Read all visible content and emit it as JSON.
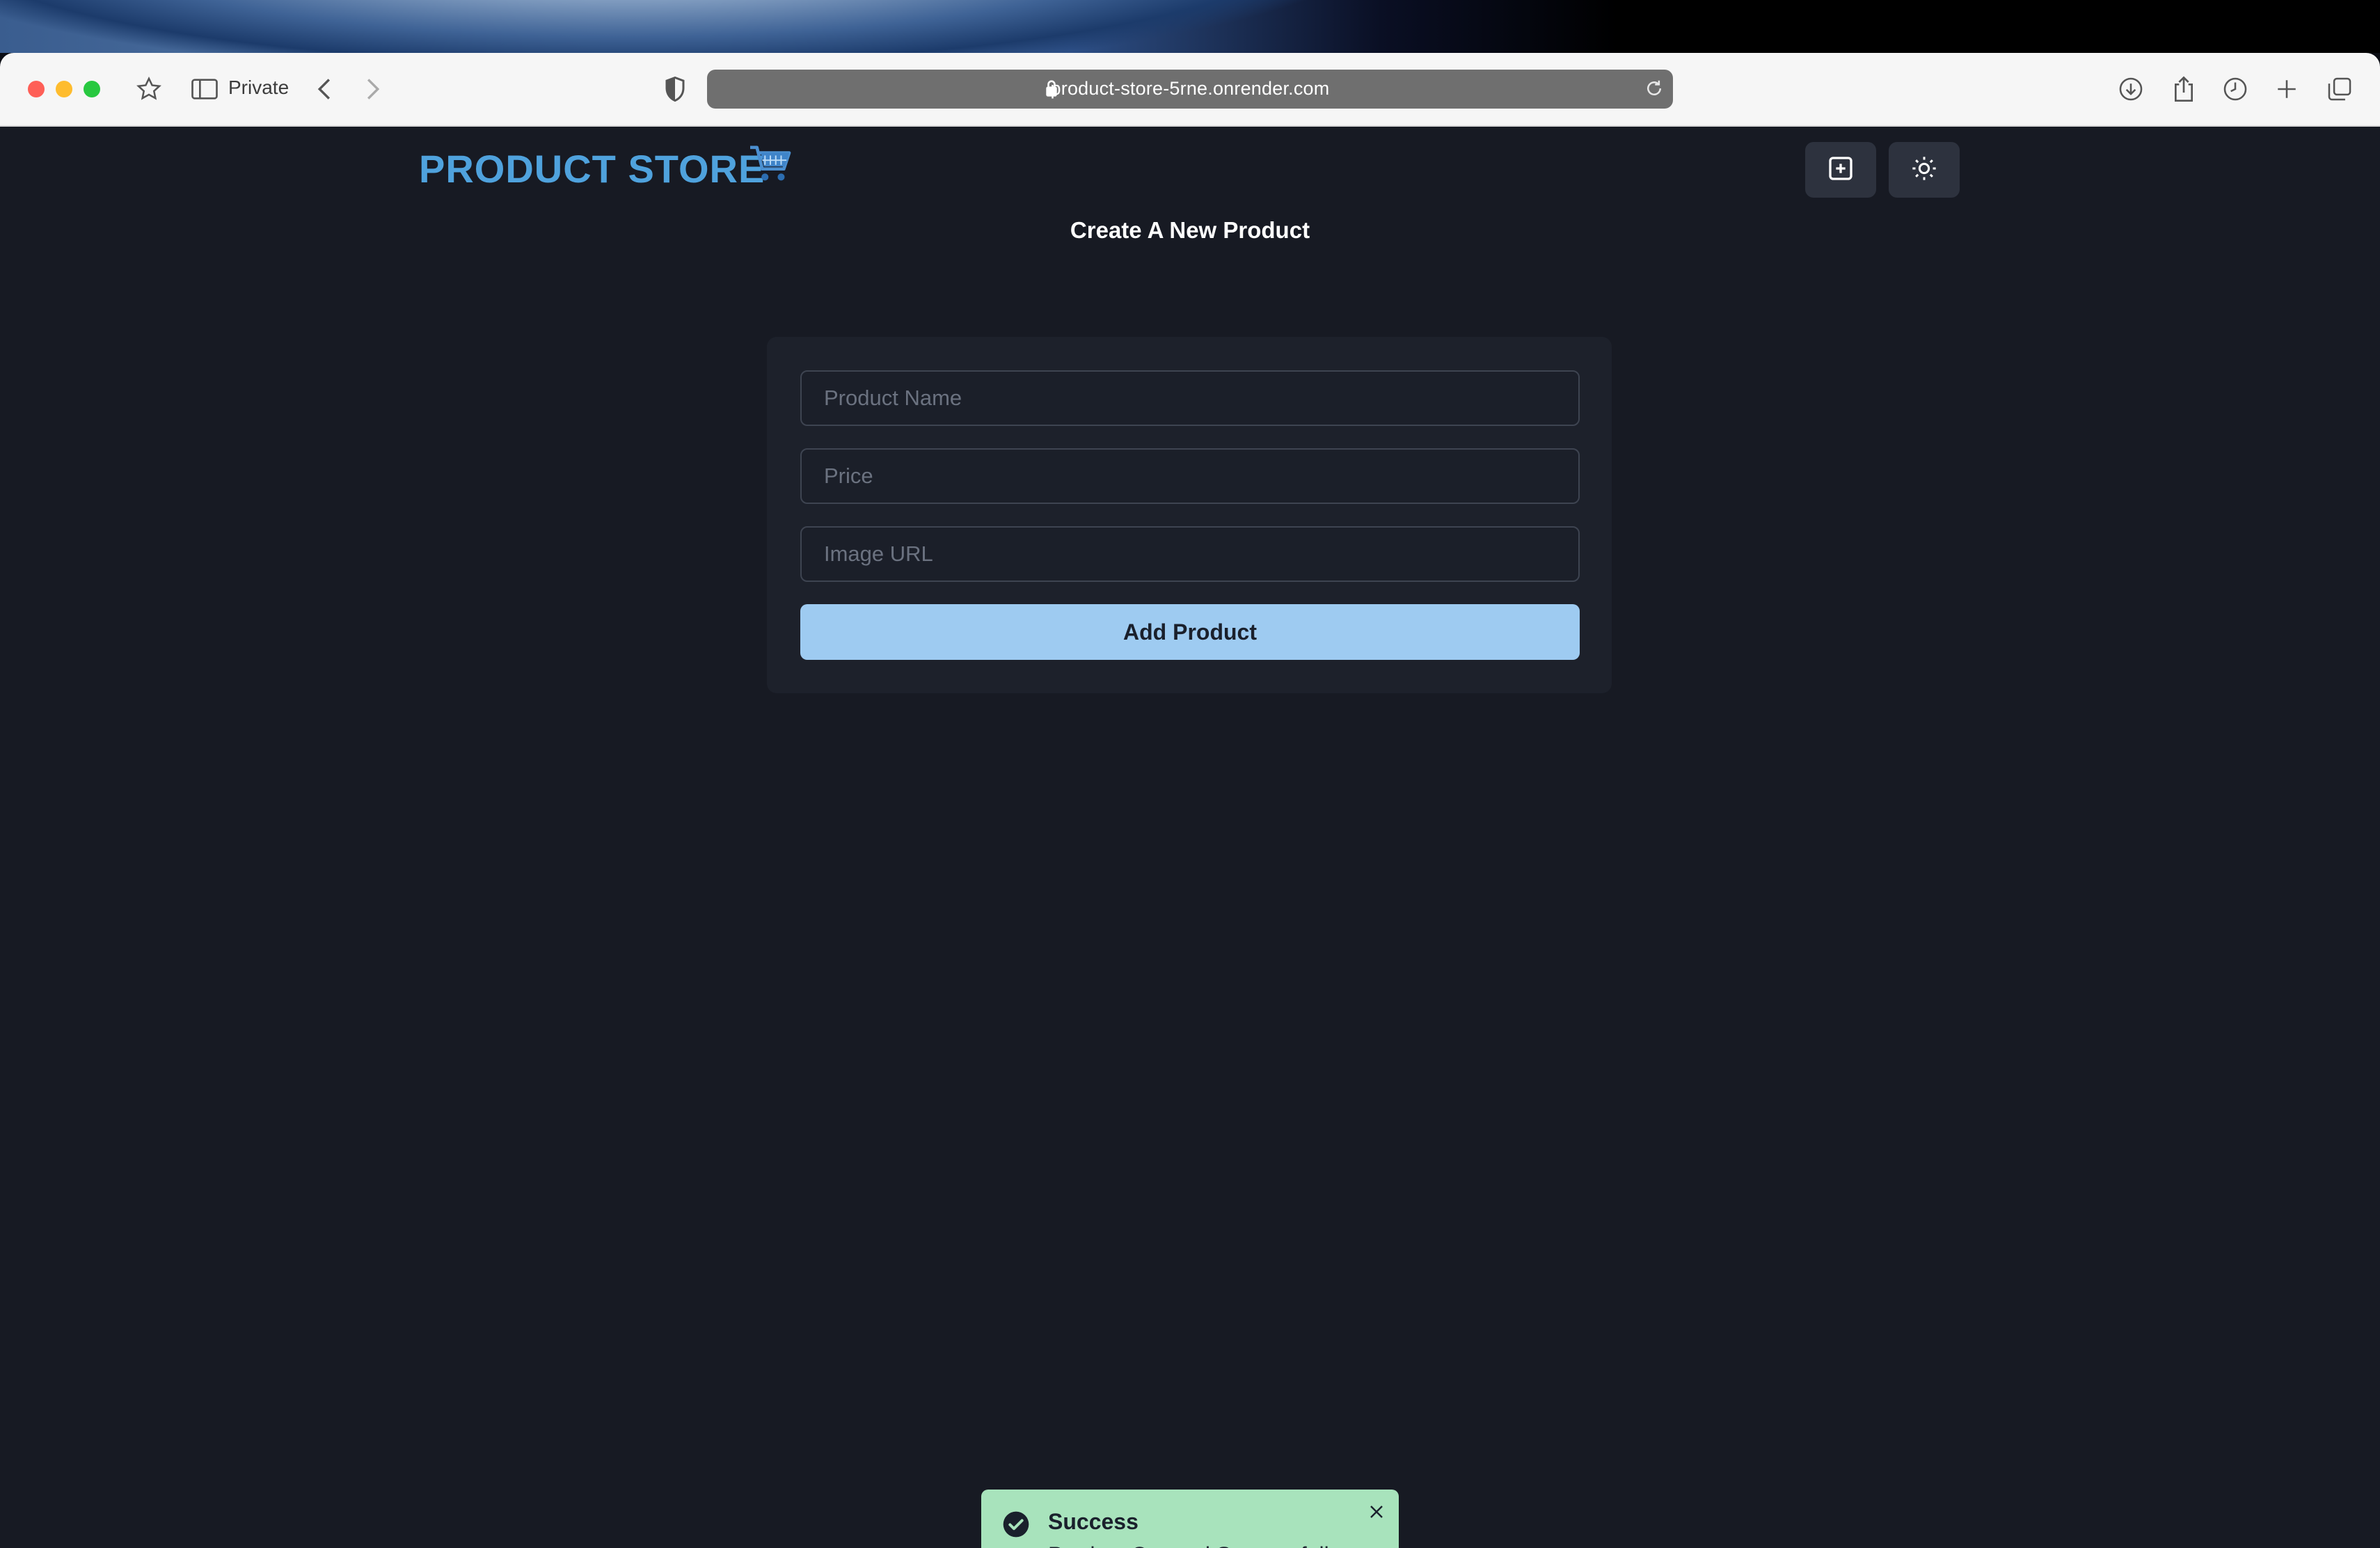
{
  "browser": {
    "private_label": "Private",
    "url": "product-store-5rne.onrender.com"
  },
  "header": {
    "brand": "PRODUCT STORE",
    "brand_icon": "shopping-cart-icon",
    "create_button_icon": "plus-square-icon",
    "theme_button_icon": "sun-icon"
  },
  "main": {
    "title": "Create A New Product",
    "form": {
      "name_placeholder": "Product Name",
      "name_value": "",
      "price_placeholder": "Price",
      "price_value": "",
      "image_placeholder": "Image URL",
      "image_value": "",
      "submit_label": "Add Product"
    }
  },
  "toast": {
    "title": "Success",
    "description": "Product Created Successfully",
    "icon": "check-circle-icon",
    "status_color": "#a8e3bc"
  },
  "colors": {
    "accent": "#4fa2dd",
    "button": "#9ecbf1",
    "page_background": "#171a23"
  }
}
